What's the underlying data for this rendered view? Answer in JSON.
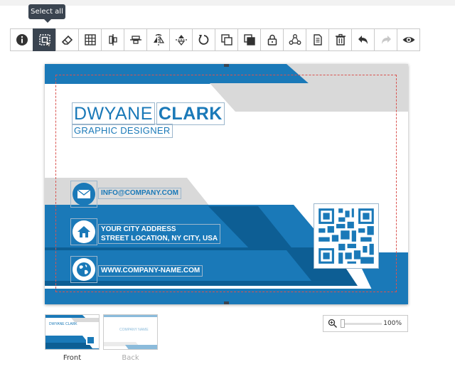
{
  "tooltip": "Select all",
  "toolbar": {
    "tools": [
      "info-icon",
      "select-all-icon",
      "eraser-icon",
      "grid-icon",
      "align-vertical-icon",
      "align-horizontal-icon",
      "flip-horizontal-icon",
      "flip-vertical-icon",
      "rotate-icon",
      "bring-forward-icon",
      "send-backward-icon",
      "lock-icon",
      "group-icon",
      "copy-icon",
      "delete-icon",
      "undo-icon",
      "redo-icon",
      "preview-icon"
    ],
    "active": "select-all-icon"
  },
  "card": {
    "first_name": "DWYANE",
    "last_name": "CLARK",
    "job_title": "GRAPHIC DESIGNER",
    "email": "INFO@COMPANY.COM",
    "address_line1": "YOUR CITY ADDRESS",
    "address_line2": "STREET LOCATION, NY CITY, USA",
    "website": "WWW.COMPANY-NAME.COM",
    "colors": {
      "primary": "#1a79b8",
      "dark": "#0d5e94",
      "grey": "#d9d9d9"
    }
  },
  "pages": {
    "front": "Front",
    "back": "Back",
    "active": "Front"
  },
  "zoom": {
    "value": "100%",
    "level": 0.0
  }
}
